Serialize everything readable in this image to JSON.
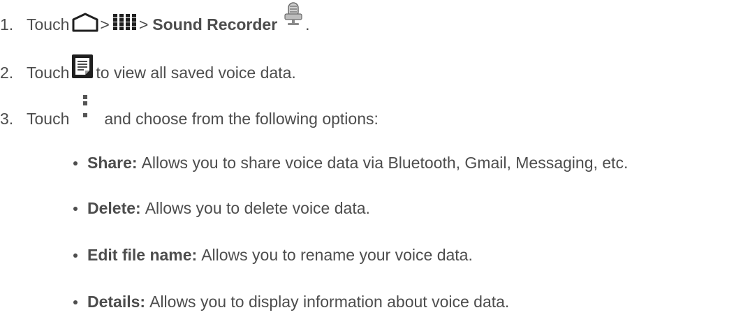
{
  "steps": [
    {
      "number": "1.",
      "touch": "Touch",
      "sep1": ">",
      "sep2": ">",
      "app_name": "Sound Recorder",
      "end": ".",
      "icons": [
        "home-icon",
        "apps-grid-icon",
        "microphone-app-icon"
      ]
    },
    {
      "number": "2.",
      "touch": "Touch",
      "text": "to view all saved voice data.",
      "icons": [
        "list-icon"
      ]
    },
    {
      "number": "3.",
      "touch": "Touch",
      "text": "and choose from the following options:",
      "icons": [
        "menu-overflow-icon"
      ]
    }
  ],
  "options": [
    {
      "term": "Share:",
      "desc": "Allows you to share voice data via Bluetooth, Gmail, Messaging, etc."
    },
    {
      "term": "Delete:",
      "desc": "Allows you to delete voice data."
    },
    {
      "term": "Edit file name:",
      "desc": "Allows you to rename your voice data."
    },
    {
      "term": "Details:",
      "desc": "Allows you to display information about voice data."
    }
  ],
  "colors": {
    "text": "#4d4d4d",
    "icon_dark": "#1f1f1f",
    "bullet": "#4d4d4d"
  }
}
